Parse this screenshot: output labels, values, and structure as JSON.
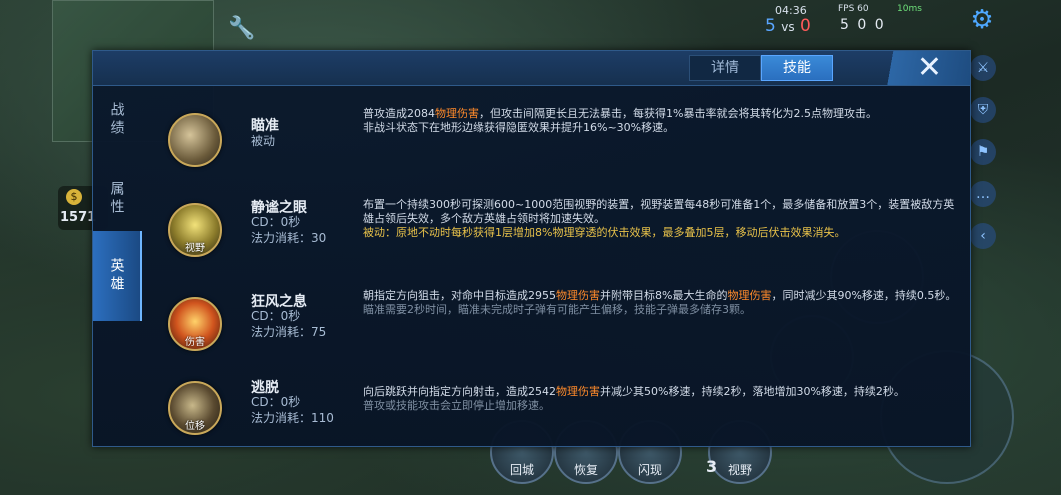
{
  "hud": {
    "time": "04:36",
    "score_blue": "5",
    "score_vs": "vs",
    "score_red": "0",
    "fps": "FPS 60",
    "ping": "10ms",
    "stats": "5 0 0",
    "gold": "1571",
    "gold_icon": "$",
    "level": "3"
  },
  "bottom_buttons": [
    {
      "label": "回城"
    },
    {
      "label": "恢复"
    },
    {
      "label": "闪现"
    },
    {
      "label": "视野"
    }
  ],
  "panel": {
    "top_tabs": [
      {
        "label": "详情",
        "active": false
      },
      {
        "label": "技能",
        "active": true
      }
    ],
    "close_label": "✕",
    "side_tabs": [
      {
        "label": "战绩",
        "active": false
      },
      {
        "label": "属性",
        "active": false
      },
      {
        "label": "英雄",
        "active": true
      }
    ],
    "skills": [
      {
        "name": "瞄准",
        "meta": [
          "被动"
        ],
        "icon_tag": "",
        "desc": [
          {
            "t": "普攻造成2084",
            "c": ""
          },
          {
            "t": "物理伤害",
            "c": "hl"
          },
          {
            "t": "，但攻击间隔更长且无法暴击，每获得1%暴击率就会将其转化为2.5点物理攻击。",
            "c": ""
          },
          {
            "t": "\n非战斗状态下在地形边缘获得隐匿效果并提升16%~30%移速。",
            "c": ""
          }
        ]
      },
      {
        "name": "静谧之眼",
        "meta": [
          "CD：0秒",
          "法力消耗：30"
        ],
        "icon_tag": "视野",
        "desc": [
          {
            "t": "布置一个持续300秒可探测600~1000范围视野的装置，视野装置每48秒可准备1个，最多储备和放置3个，装置被敌方英雄占领后失效，多个敌方英雄占领时将加速失效。",
            "c": ""
          },
          {
            "t": "\n被动：原地不动时每秒获得1层增加8%物理穿透的伏击效果，最多叠加5层，移动后伏击效果消失。",
            "c": "yl"
          }
        ]
      },
      {
        "name": "狂风之息",
        "meta": [
          "CD：0秒",
          "法力消耗：75"
        ],
        "icon_tag": "伤害",
        "desc": [
          {
            "t": "朝指定方向狙击，对命中目标造成2955",
            "c": ""
          },
          {
            "t": "物理伤害",
            "c": "hl"
          },
          {
            "t": "并附带目标8%最大生命的",
            "c": ""
          },
          {
            "t": "物理伤害",
            "c": "hl"
          },
          {
            "t": "，同时减少其90%移速，持续0.5秒。",
            "c": ""
          },
          {
            "t": "\n瞄准需要2秒时间，瞄准未完成时子弹有可能产生偏移，技能子弹最多储存3颗。",
            "c": "dim"
          }
        ]
      },
      {
        "name": "逃脱",
        "meta": [
          "CD：0秒",
          "法力消耗：110"
        ],
        "icon_tag": "位移",
        "desc": [
          {
            "t": "向后跳跃并向指定方向射击，造成2542",
            "c": ""
          },
          {
            "t": "物理伤害",
            "c": "hl"
          },
          {
            "t": "并减少其50%移速，持续2秒，落地增加30%移速，持续2秒。",
            "c": ""
          },
          {
            "t": "\n普攻或技能攻击会立即停止增加移速。",
            "c": "dim"
          }
        ]
      }
    ]
  }
}
